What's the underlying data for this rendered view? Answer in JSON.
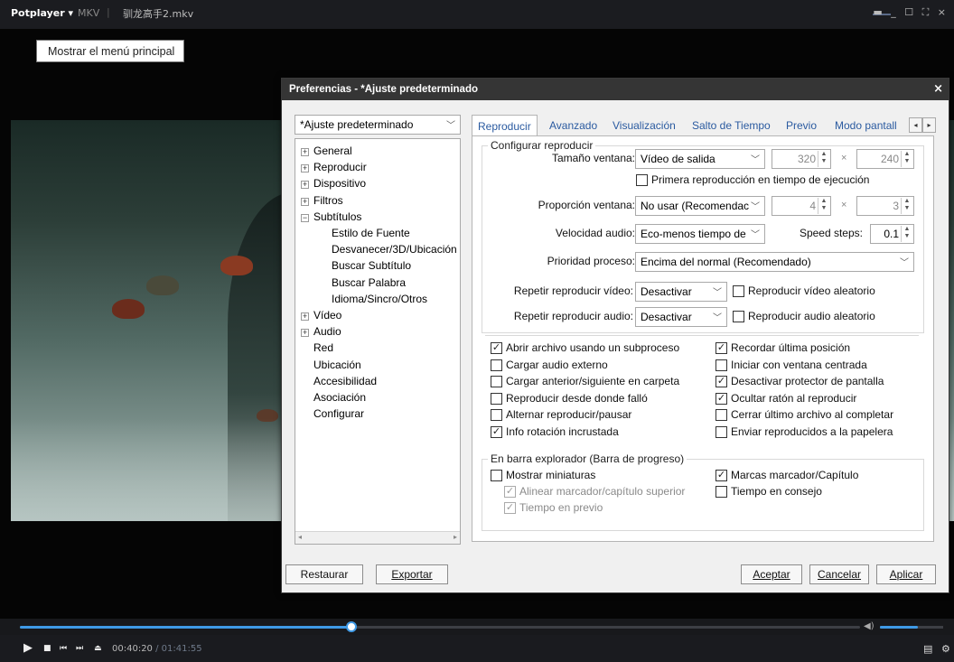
{
  "player": {
    "brand": "Potplayer ▾",
    "format": "MKV",
    "separator": "|",
    "filename": "驯龙高手2.mkv",
    "tooltip": "Mostrar el menú principal",
    "window_controls": "▬ _ ☐ ⛶ ×",
    "progress": 0.395,
    "volume": 0.6,
    "time_current": "00:40:20",
    "time_separator": " / ",
    "time_total": "01:41:55",
    "accent_color": "#3f9ae6"
  },
  "dialog": {
    "title": "Preferencias - *Ajuste predeterminado",
    "close": "×",
    "preset": "*Ajuste predeterminado",
    "tree": [
      {
        "label": "General",
        "level": 0,
        "expander": "+"
      },
      {
        "label": "Reproducir",
        "level": 0,
        "expander": "+"
      },
      {
        "label": "Dispositivo",
        "level": 0,
        "expander": "+"
      },
      {
        "label": "Filtros",
        "level": 0,
        "expander": "+"
      },
      {
        "label": "Subtítulos",
        "level": 0,
        "expander": "−"
      },
      {
        "label": "Estilo de Fuente",
        "level": 1,
        "expander": ""
      },
      {
        "label": "Desvanecer/3D/Ubicación",
        "level": 1,
        "expander": ""
      },
      {
        "label": "Buscar Subtítulo",
        "level": 1,
        "expander": ""
      },
      {
        "label": "Buscar Palabra",
        "level": 1,
        "expander": ""
      },
      {
        "label": "Idioma/Sincro/Otros",
        "level": 1,
        "expander": ""
      },
      {
        "label": "Vídeo",
        "level": 0,
        "expander": "+"
      },
      {
        "label": "Audio",
        "level": 0,
        "expander": "+"
      },
      {
        "label": "Red",
        "level": 0,
        "expander": ""
      },
      {
        "label": "Ubicación",
        "level": 0,
        "expander": ""
      },
      {
        "label": "Accesibilidad",
        "level": 0,
        "expander": ""
      },
      {
        "label": "Asociación",
        "level": 0,
        "expander": ""
      },
      {
        "label": "Configurar",
        "level": 0,
        "expander": ""
      }
    ],
    "tabs": [
      "Reproducir",
      "Avanzado",
      "Visualización",
      "Salto de Tiempo",
      "Previo",
      "Modo pantall"
    ],
    "active_tab": 0,
    "group1_label": "Configurar reproducir",
    "window_size_label": "Tamaño ventana:",
    "window_size_value": "Vídeo de salida",
    "width_value": "320",
    "height_value": "240",
    "times": "×",
    "first_play_label": "Primera reproducción en tiempo de ejecución",
    "aspect_label": "Proporción ventana:",
    "aspect_value": "No usar (Recomendac",
    "aspect_w": "4",
    "aspect_h": "3",
    "audio_speed_label": "Velocidad audio:",
    "audio_speed_value": "Eco-menos tiempo de",
    "speed_steps_label": "Speed steps:",
    "speed_steps_value": "0.1",
    "priority_label": "Prioridad proceso:",
    "priority_value": "Encima del normal (Recomendado)",
    "repeat_video_label": "Repetir reproducir vídeo:",
    "repeat_video_value": "Desactivar",
    "random_video_label": "Reproducir vídeo aleatorio",
    "repeat_audio_label": "Repetir reproducir audio:",
    "repeat_audio_value": "Desactivar",
    "random_audio_label": "Reproducir audio aleatorio",
    "options_left": [
      {
        "label": "Abrir archivo usando un subproceso",
        "checked": true
      },
      {
        "label": "Cargar audio externo",
        "checked": false
      },
      {
        "label": "Cargar anterior/siguiente en carpeta",
        "checked": false
      },
      {
        "label": "Reproducir desde donde falló",
        "checked": false
      },
      {
        "label": "Alternar reproducir/pausar",
        "checked": false
      },
      {
        "label": "Info rotación incrustada",
        "checked": true
      }
    ],
    "options_right": [
      {
        "label": "Recordar última posición",
        "checked": true
      },
      {
        "label": "Iniciar con ventana centrada",
        "checked": false
      },
      {
        "label": "Desactivar protector de pantalla",
        "checked": true
      },
      {
        "label": "Ocultar ratón al reproducir",
        "checked": true
      },
      {
        "label": "Cerrar último archivo al completar",
        "checked": false
      },
      {
        "label": "Enviar reproducidos a la papelera",
        "checked": false
      }
    ],
    "group2_label": "En barra explorador (Barra de progreso)",
    "thumbs_label": "Mostrar miniaturas",
    "align_label": "Alinear marcador/capítulo superior",
    "preview_time_label": "Tiempo en previo",
    "chapter_marks_label": "Marcas marcador/Capítulo",
    "tooltip_time_label": "Tiempo en consejo",
    "buttons": {
      "restore": "Restaurar",
      "export": "Exportar",
      "accept": "Aceptar",
      "cancel": "Cancelar",
      "apply": "Aplicar"
    }
  }
}
